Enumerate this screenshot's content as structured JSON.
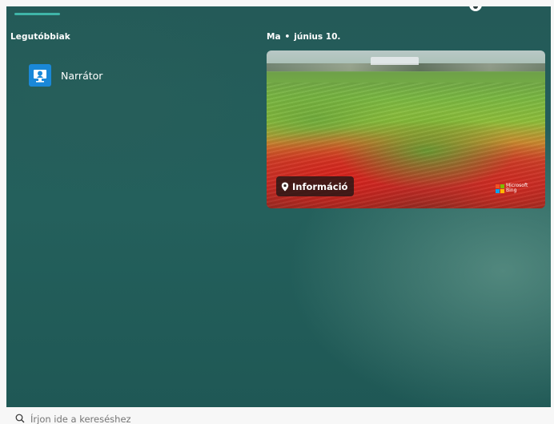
{
  "start_menu": {
    "recent_section": {
      "title": "Legutóbbiak",
      "items": [
        {
          "label": "Narrátor",
          "icon": "narrator-icon"
        }
      ]
    },
    "spotlight": {
      "day": "Ma",
      "separator": "•",
      "date": "június 10.",
      "info_button_label": "Információ",
      "brand_line1": "Microsoft",
      "brand_line2": "Bing"
    }
  },
  "search": {
    "placeholder": "Írjon ide a kereséshez"
  },
  "colors": {
    "panel_background": "#245a58",
    "accent_indicator": "#3fb5a8",
    "narrator_tile": "#1a88d8",
    "ms_red": "#f25022",
    "ms_green": "#7fba00",
    "ms_blue": "#00a4ef",
    "ms_yellow": "#ffb900"
  }
}
